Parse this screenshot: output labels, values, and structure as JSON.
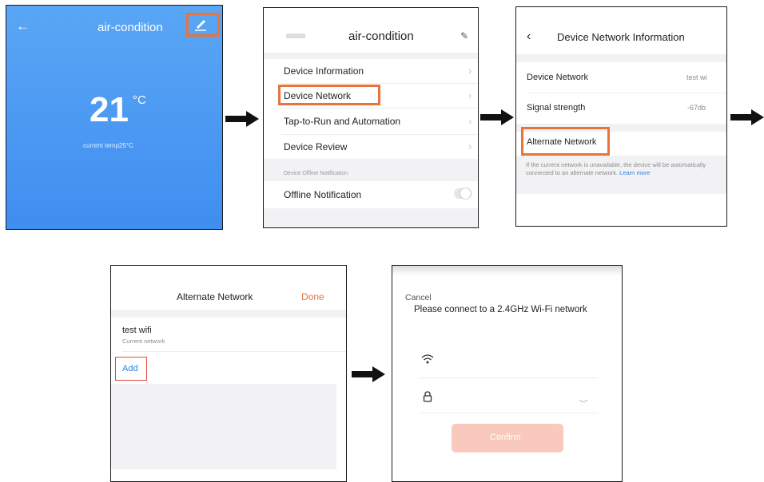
{
  "panel1": {
    "back_icon": "arrow-left-icon",
    "title": "air-condition",
    "edit_icon": "edit-pencil-icon",
    "temperature": "21",
    "unit": "°C",
    "current_temp": "current temp25°C"
  },
  "panel2": {
    "device_icon": "ac-unit-icon",
    "title": "air-condition",
    "edit_icon": "edit-pencil-icon",
    "items": [
      {
        "label": "Device Information"
      },
      {
        "label": "Device Network"
      },
      {
        "label": "Tap-to-Run and Automation"
      },
      {
        "label": "Device Review"
      }
    ],
    "section_header": "Device Offline Notification",
    "offline_label": "Offline Notification",
    "offline_toggle": false
  },
  "panel3": {
    "back_icon": "chevron-left-icon",
    "title": "Device Network Information",
    "rows": [
      {
        "label": "Device Network",
        "value": "test wi"
      },
      {
        "label": "Signal strength",
        "value": "-67db"
      }
    ],
    "alternate_label": "Alternate Network",
    "note": "If the current network is unavailable, the device will be automatically connected to an alternate network.",
    "learn_more": "Learn more"
  },
  "panel4": {
    "title": "Alternate Network",
    "done": "Done",
    "network_name": "test wifi",
    "network_sub": "Current network",
    "add": "Add"
  },
  "panel5": {
    "cancel": "Cancel",
    "heading": "Please connect to a 2.4GHz Wi-Fi network",
    "wifi_icon": "wifi-icon",
    "lock_icon": "lock-icon",
    "eye_icon": "eye-closed-icon",
    "confirm": "Confirm"
  },
  "colors": {
    "highlight": "#e8743b",
    "panel1_bg": "#4a98f3",
    "link_blue": "#2b7de9",
    "done_orange": "#e8743b",
    "confirm_bg": "#f8c9bc"
  }
}
